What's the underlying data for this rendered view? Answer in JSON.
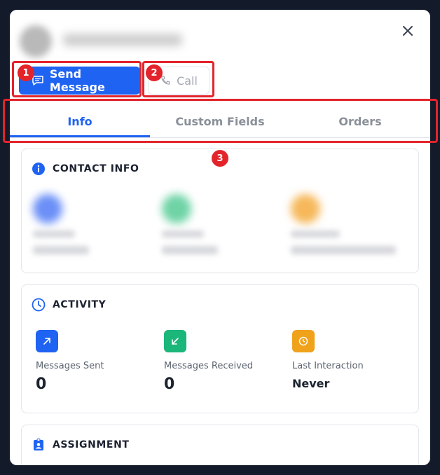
{
  "actions": {
    "send_label": "Send Message",
    "call_label": "Call"
  },
  "tabs": [
    {
      "label": "Info"
    },
    {
      "label": "Custom Fields"
    },
    {
      "label": "Orders"
    }
  ],
  "contact_info": {
    "title": "CONTACT INFO"
  },
  "activity": {
    "title": "ACTIVITY",
    "stats": [
      {
        "label": "Messages Sent",
        "value": "0",
        "color": "#1f63f2",
        "icon": "arrow-up-right-icon"
      },
      {
        "label": "Messages Received",
        "value": "0",
        "color": "#1ab67a",
        "icon": "arrow-down-left-icon"
      },
      {
        "label": "Last Interaction",
        "value": "Never",
        "color": "#f0a21a",
        "icon": "clock-icon"
      }
    ]
  },
  "assignment": {
    "title": "ASSIGNMENT"
  },
  "annotations": [
    {
      "n": "1"
    },
    {
      "n": "2"
    },
    {
      "n": "3"
    }
  ],
  "colors": {
    "accent": "#1f63f2",
    "annotation": "#e3242b",
    "backdrop": "#131a2a"
  }
}
